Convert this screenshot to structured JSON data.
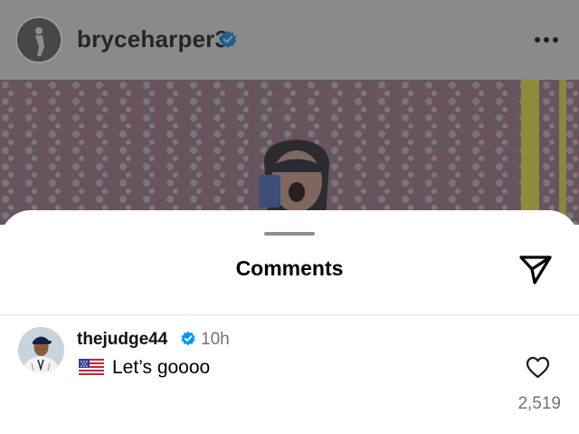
{
  "post": {
    "username": "bryceharper3",
    "verified_icon": "verified-badge-icon",
    "more_icon": "more-options-icon"
  },
  "sheet": {
    "title": "Comments",
    "share_icon": "share-send-icon"
  },
  "comment": {
    "username": "thejudge44",
    "verified_icon": "verified-badge-icon",
    "time": "10h",
    "flag_icon": "us-flag-icon",
    "text": "Let’s goooo",
    "like_icon": "heart-outline-icon",
    "like_count": "2,519"
  },
  "colors": {
    "verified": "#0095f6",
    "dim_overlay": "#8a8a8a",
    "secondary_text": "#737373"
  }
}
